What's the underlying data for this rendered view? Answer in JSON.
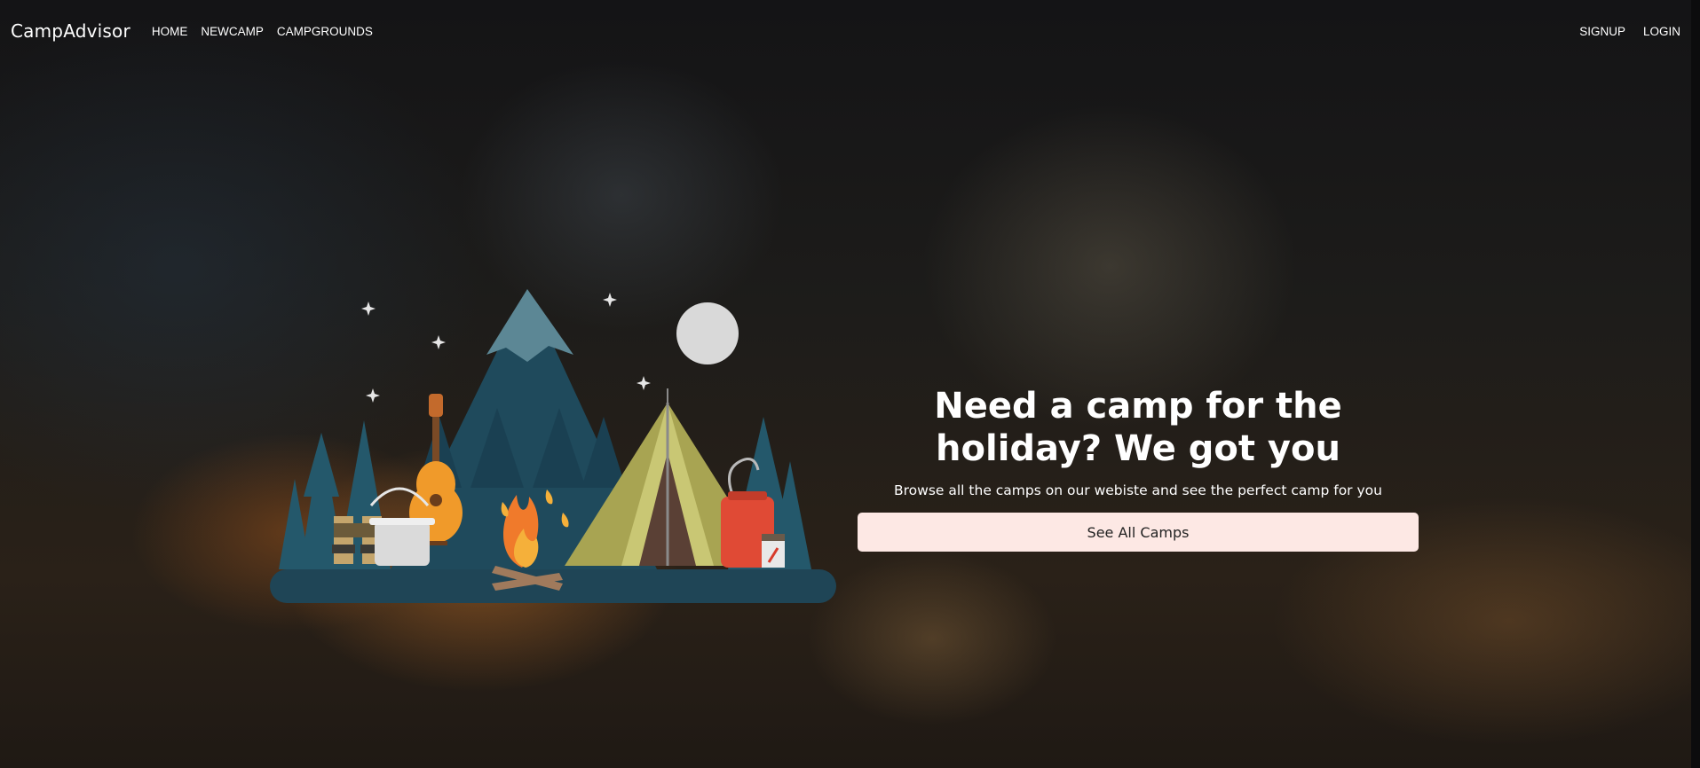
{
  "navbar": {
    "brand": "CampAdvisor",
    "links": [
      "HOME",
      "NEWCAMP",
      "CAMPGROUNDS"
    ],
    "auth": [
      "SIGNUP",
      "LOGIN"
    ]
  },
  "hero": {
    "title": "Need a camp for the holiday? We got you",
    "subtitle": "Browse all the camps on our webiste and see the perfect camp for you",
    "button_label": "See All Camps"
  },
  "colors": {
    "button_bg": "#fde8e4",
    "mountain": "#1f4a5c",
    "tent": "#a8a452",
    "campfire": "#f07a2b"
  },
  "icons": [
    "campsite-illustration"
  ]
}
